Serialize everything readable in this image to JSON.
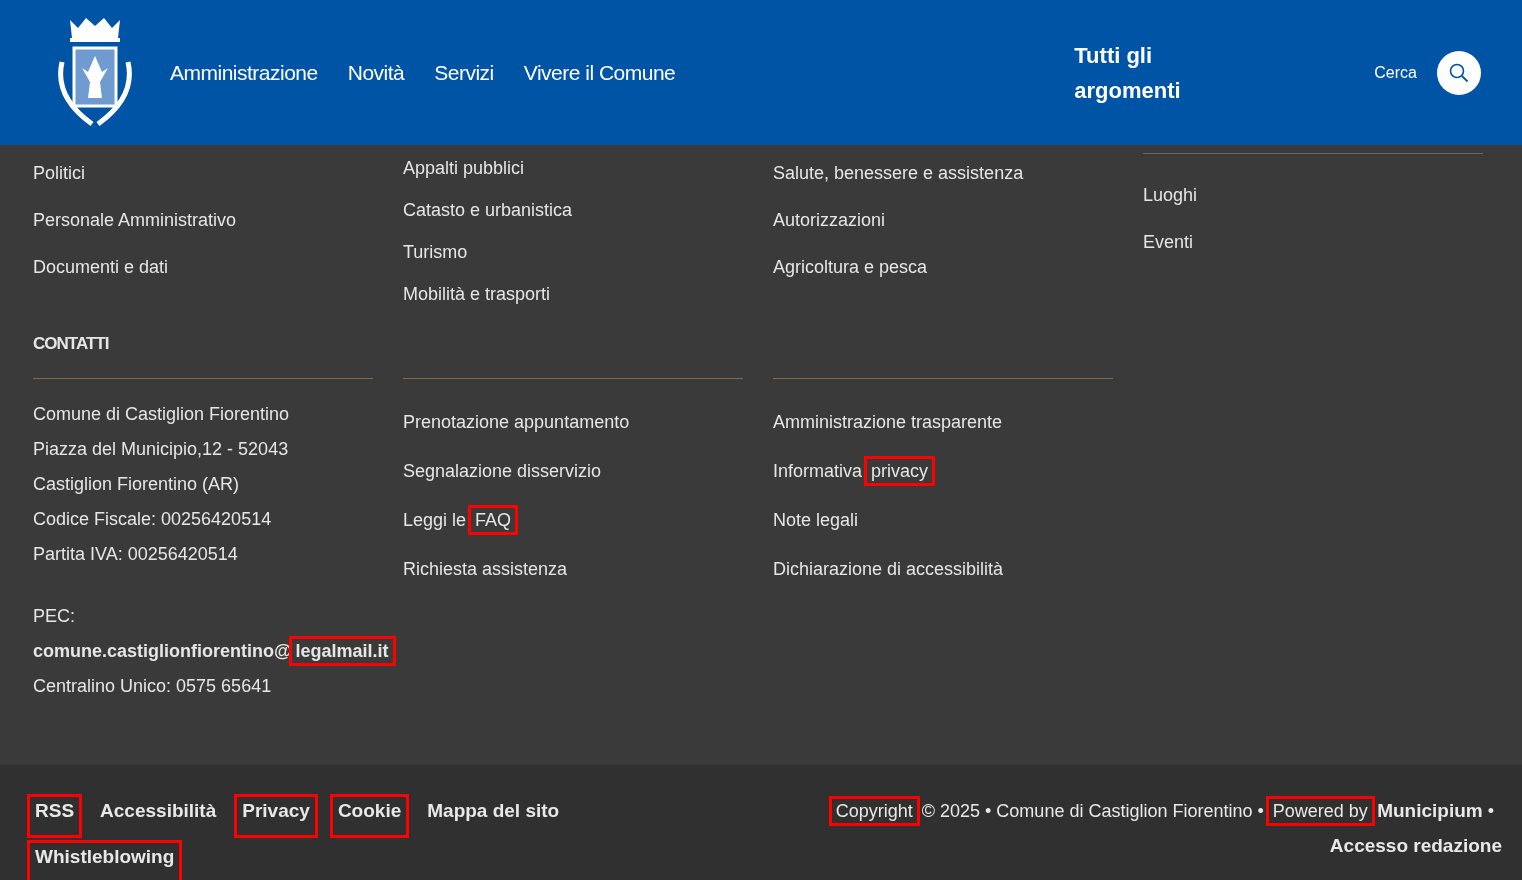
{
  "header": {
    "nav": [
      "Amministrazione",
      "Novità",
      "Servizi",
      "Vivere il Comune"
    ],
    "topics": "Tutti gli argomenti",
    "search_label": "Cerca"
  },
  "link_columns": [
    {
      "links": [
        {
          "parts": [
            {
              "text": "Politici",
              "highlighted": false
            }
          ]
        },
        {
          "parts": [
            {
              "text": "Personale Amministrativo",
              "highlighted": false
            }
          ]
        },
        {
          "parts": [
            {
              "text": "Documenti e dati",
              "highlighted": false
            }
          ]
        }
      ]
    },
    {
      "links": [
        {
          "parts": [
            {
              "text": "Appalti pubblici",
              "highlighted": false
            }
          ]
        },
        {
          "parts": [
            {
              "text": "Catasto e urbanistica",
              "highlighted": false
            }
          ]
        },
        {
          "parts": [
            {
              "text": "Turismo",
              "highlighted": false
            }
          ]
        },
        {
          "parts": [
            {
              "text": "Mobilità e trasporti",
              "highlighted": false
            }
          ]
        }
      ]
    },
    {
      "links": [
        {
          "parts": [
            {
              "text": "Salute, benessere e assistenza",
              "highlighted": false
            }
          ]
        },
        {
          "parts": [
            {
              "text": "Autorizzazioni",
              "highlighted": false
            }
          ]
        },
        {
          "parts": [
            {
              "text": "Agricoltura e pesca",
              "highlighted": false
            }
          ]
        }
      ]
    },
    {
      "links": [
        {
          "parts": [
            {
              "text": "Luoghi",
              "highlighted": false
            }
          ]
        },
        {
          "parts": [
            {
              "text": "Eventi",
              "highlighted": false
            }
          ]
        }
      ]
    }
  ],
  "contacts": {
    "heading": "CONTATTI",
    "lines": [
      "Comune di Castiglion Fiorentino",
      "Piazza del Municipio,12 - 52043",
      "Castiglion Fiorentino (AR)",
      "Codice Fiscale: 00256420514",
      "Partita IVA: 00256420514"
    ],
    "pec_label": "PEC:",
    "pec": [
      {
        "text": "comune.castiglionfiorentino@",
        "highlighted": false
      },
      {
        "text": "legalmail.it",
        "highlighted": true
      }
    ],
    "phone": "Centralino Unico: 0575 65641"
  },
  "service_links": [
    {
      "parts": [
        {
          "text": "Prenotazione appuntamento",
          "highlighted": false
        }
      ]
    },
    {
      "parts": [
        {
          "text": "Segnalazione disservizio",
          "highlighted": false
        }
      ]
    },
    {
      "parts": [
        {
          "text": "Leggi le ",
          "highlighted": false
        },
        {
          "text": "FAQ",
          "highlighted": true
        }
      ]
    },
    {
      "parts": [
        {
          "text": "Richiesta assistenza",
          "highlighted": false
        }
      ]
    }
  ],
  "info_links": [
    {
      "parts": [
        {
          "text": "Amministrazione trasparente",
          "highlighted": false
        }
      ]
    },
    {
      "parts": [
        {
          "text": "Informativa ",
          "highlighted": false
        },
        {
          "text": "privacy",
          "highlighted": true
        }
      ]
    },
    {
      "parts": [
        {
          "text": "Note legali",
          "highlighted": false
        }
      ]
    },
    {
      "parts": [
        {
          "text": "Dichiarazione di accessibilità",
          "highlighted": false
        }
      ]
    }
  ],
  "footer": {
    "links": [
      {
        "text": "RSS",
        "highlighted": true
      },
      {
        "text": "Accessibilità",
        "highlighted": false
      },
      {
        "text": "Privacy",
        "highlighted": true
      },
      {
        "text": "Cookie",
        "highlighted": true
      },
      {
        "text": "Mappa del sito",
        "highlighted": false
      },
      {
        "text": "Whistleblowing",
        "highlighted": true
      }
    ],
    "credits": [
      {
        "text": "Copyright",
        "highlighted": true,
        "bold": false
      },
      {
        "text": " © 2025 • Comune di Castiglion Fiorentino • ",
        "highlighted": false,
        "bold": false
      },
      {
        "text": "Powered by",
        "highlighted": true,
        "bold": false
      },
      {
        "text": " Municipium",
        "highlighted": false,
        "bold": true
      },
      {
        "text": " •",
        "highlighted": false,
        "bold": false
      }
    ],
    "login": "Accesso redazione"
  }
}
